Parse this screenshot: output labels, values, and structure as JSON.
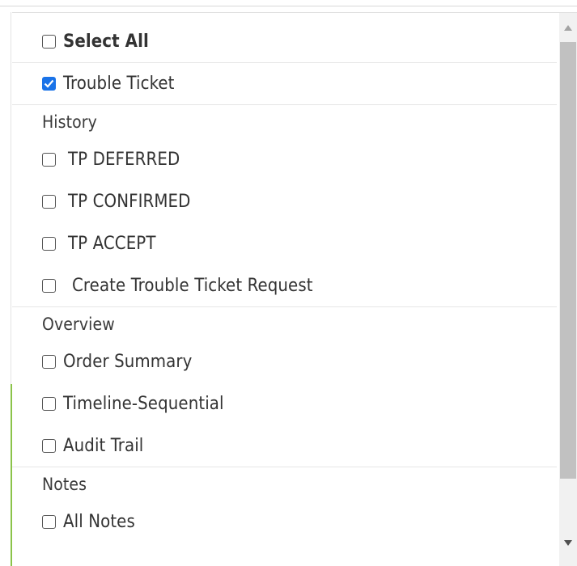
{
  "select_all": {
    "label": "Select All",
    "checked": false
  },
  "items_top": [
    {
      "label": "Trouble Ticket",
      "checked": true
    }
  ],
  "sections": [
    {
      "title": "History",
      "items": [
        {
          "label": "TP DEFERRED",
          "checked": false
        },
        {
          "label": "TP CONFIRMED",
          "checked": false
        },
        {
          "label": "TP ACCEPT",
          "checked": false
        },
        {
          "label": "Create Trouble Ticket Request",
          "checked": false
        }
      ]
    },
    {
      "title": "Overview",
      "items": [
        {
          "label": "Order Summary",
          "checked": false
        },
        {
          "label": "Timeline-Sequential",
          "checked": false
        },
        {
          "label": "Audit Trail",
          "checked": false
        }
      ]
    },
    {
      "title": "Notes",
      "items": [
        {
          "label": "All Notes",
          "checked": false
        }
      ]
    }
  ],
  "colors": {
    "checkbox_checked": "#1a73e8",
    "accent_green": "#8bc34a"
  },
  "icons": {
    "scroll_up": "triangle-up-icon",
    "scroll_down": "triangle-down-icon",
    "check": "checkmark-icon"
  }
}
